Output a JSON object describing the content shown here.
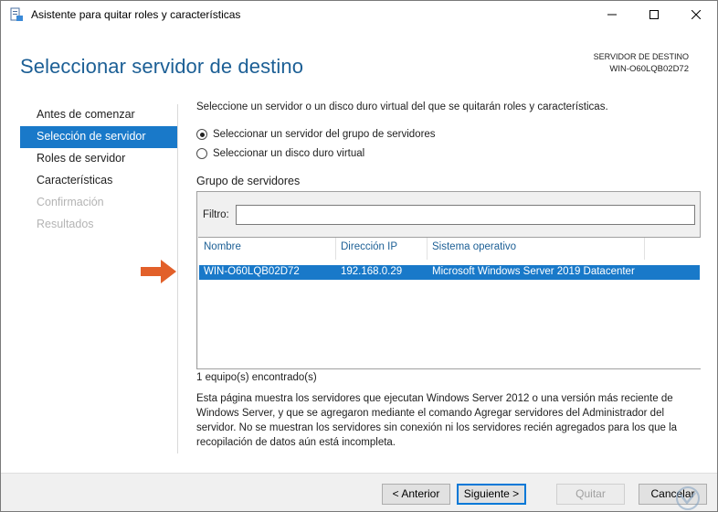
{
  "window": {
    "title": "Asistente para quitar roles y características"
  },
  "header": {
    "page_title": "Seleccionar servidor de destino",
    "dest_label": "SERVIDOR DE DESTINO",
    "dest_value": "WIN-O60LQB02D72"
  },
  "nav": {
    "items": [
      {
        "label": "Antes de comenzar",
        "state": "normal"
      },
      {
        "label": "Selección de servidor",
        "state": "active"
      },
      {
        "label": "Roles de servidor",
        "state": "normal"
      },
      {
        "label": "Características",
        "state": "normal"
      },
      {
        "label": "Confirmación",
        "state": "disabled"
      },
      {
        "label": "Resultados",
        "state": "disabled"
      }
    ]
  },
  "main": {
    "intro": "Seleccione un servidor o un disco duro virtual del que se quitarán roles y características.",
    "radio_server_pool": "Seleccionar un servidor del grupo de servidores",
    "radio_vhd": "Seleccionar un disco duro virtual",
    "group_label": "Grupo de servidores",
    "filter_label": "Filtro:",
    "filter_value": "",
    "columns": [
      "Nombre",
      "Dirección IP",
      "Sistema operativo"
    ],
    "rows": [
      {
        "name": "WIN-O60LQB02D72",
        "ip": "192.168.0.29",
        "os": "Microsoft Windows Server 2019 Datacenter",
        "selected": true
      }
    ],
    "count": "1 equipo(s) encontrado(s)",
    "description": "Esta página muestra los servidores que ejecutan Windows Server 2012 o una versión más reciente de Windows Server, y que se agregaron mediante el comando Agregar servidores del Administrador del servidor. No se muestran los servidores sin conexión ni los servidores recién agregados para los que la recopilación de datos aún está incompleta."
  },
  "footer": {
    "back": "< Anterior",
    "next": "Siguiente >",
    "remove": "Quitar",
    "cancel": "Cancelar"
  },
  "colors": {
    "accent": "#1979c9",
    "title_blue": "#1c5f95",
    "arrow": "#e2602a"
  },
  "icons": [
    "wizard-app-icon",
    "minimize-icon",
    "maximize-icon",
    "close-icon",
    "arrow-right-icon",
    "watermark-logo-icon"
  ]
}
